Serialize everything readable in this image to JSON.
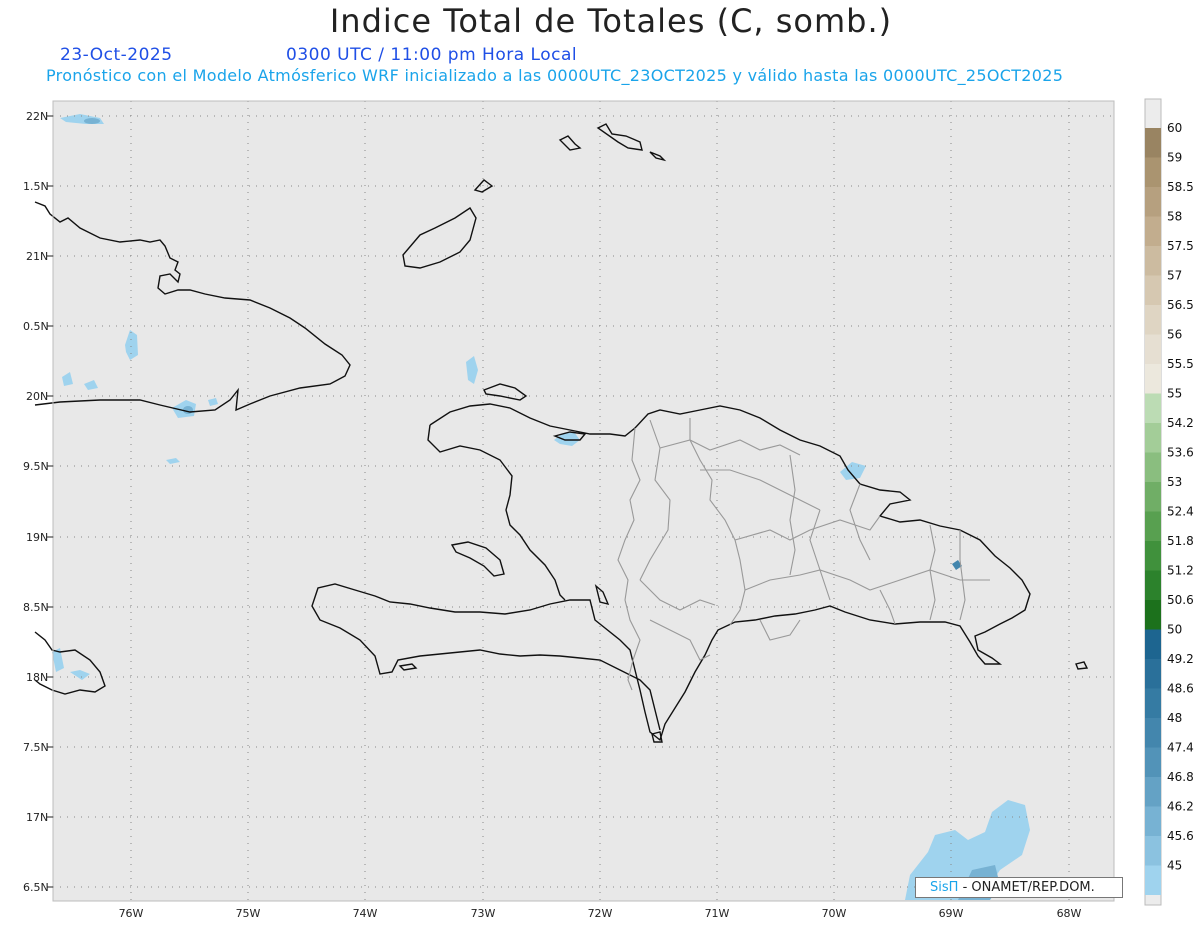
{
  "title": "Indice Total de Totales (C, somb.)",
  "date": "23-Oct-2025",
  "time": "0300 UTC / 11:00 pm Hora Local",
  "description": "Pronóstico con el Modelo Atmósferico WRF inicializado a las 0000UTC_23OCT2025 y válido hasta las  0000UTC_25OCT2025",
  "credit": {
    "brand": "SisΠ",
    "text": "- ONAMET/REP.DOM."
  },
  "lat_labels": [
    "22N",
    "1.5N",
    "21N",
    "0.5N",
    "20N",
    "9.5N",
    "19N",
    "8.5N",
    "18N",
    "7.5N",
    "17N",
    "6.5N"
  ],
  "lon_labels": [
    "76W",
    "75W",
    "74W",
    "73W",
    "72W",
    "71W",
    "70W",
    "69W",
    "68W"
  ],
  "colorbar": {
    "labels": [
      "60",
      "59",
      "58.5",
      "58",
      "57.5",
      "57",
      "56.5",
      "56",
      "55.5",
      "55",
      "54.2",
      "53.6",
      "53",
      "52.4",
      "51.8",
      "51.2",
      "50.6",
      "50",
      "49.2",
      "48.6",
      "48",
      "47.4",
      "46.8",
      "46.2",
      "45.6",
      "45"
    ],
    "colors": [
      "#998462",
      "#aa9470",
      "#b6a07f",
      "#c2ad8e",
      "#ccbba0",
      "#d6c8b1",
      "#dfd5c3",
      "#e6dfd2",
      "#ece8dd",
      "#bcdcb4",
      "#a3cd98",
      "#8abe7f",
      "#70ae66",
      "#58a050",
      "#40913c",
      "#2c822c",
      "#1c711c",
      "#1d6590",
      "#2a709a",
      "#357ba3",
      "#4386ad",
      "#5293b8",
      "#64a2c5",
      "#77b2d3",
      "#8bc2e0",
      "#9fd3ee"
    ]
  },
  "colors": {
    "ocean": "#e8e8e8",
    "shade": "#9fd3ee",
    "shade_dark": "#77b2d3",
    "coast": "#111111",
    "province": "#999999",
    "grid": "#888888"
  }
}
